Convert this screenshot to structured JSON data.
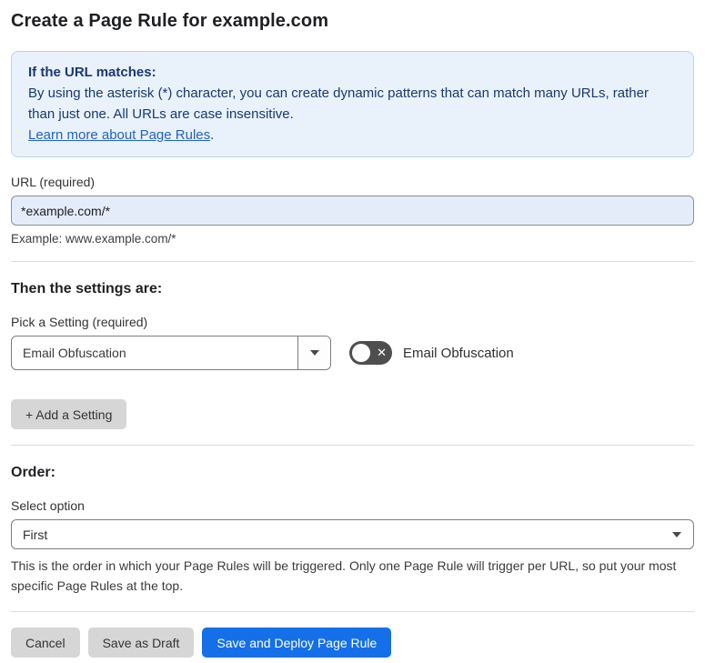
{
  "page": {
    "title": "Create a Page Rule for example.com"
  },
  "info_box": {
    "heading": "If the URL matches:",
    "body": "By using the asterisk (*) character, you can create dynamic patterns that can match many URLs, rather than just one. All URLs are case insensitive.",
    "link_text": "Learn more about Page Rules",
    "link_suffix": "."
  },
  "url_field": {
    "label": "URL (required)",
    "value": "*example.com/*",
    "example": "Example: www.example.com/*"
  },
  "settings_section": {
    "heading": "Then the settings are:",
    "picker_label": "Pick a Setting (required)",
    "selected_setting": "Email Obfuscation",
    "toggle": {
      "state": "off",
      "label": "Email Obfuscation",
      "off_glyph": "✕"
    },
    "add_button_label": "+ Add a Setting"
  },
  "order_section": {
    "heading": "Order:",
    "select_label": "Select option",
    "selected_option": "First",
    "help_text": "This is the order in which your Page Rules will be triggered. Only one Page Rule will trigger per URL, so put your most specific Page Rules at the top."
  },
  "actions": {
    "cancel_label": "Cancel",
    "save_draft_label": "Save as Draft",
    "save_deploy_label": "Save and Deploy Page Rule"
  },
  "colors": {
    "accent-blue": "#156fe8",
    "info-bg": "#e9f1fb",
    "info-border": "#b9d4ef",
    "info-text": "#1b3a6b",
    "link-blue": "#2462c4",
    "input-bg": "#e4ecfa",
    "toggle-bg": "#4e4e4e",
    "gray-btn": "#d6d6d6",
    "divider": "#dcdcdc"
  }
}
